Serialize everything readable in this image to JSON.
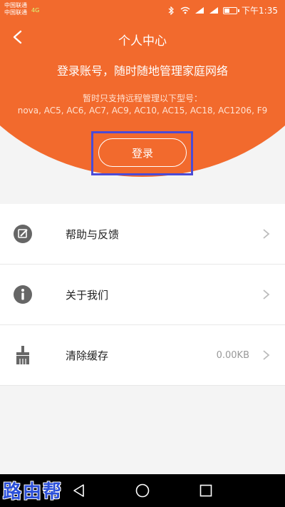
{
  "status_bar": {
    "carrier_1": "中国联通",
    "carrier_2": "中国联通",
    "net_badge": "4G",
    "time": "下午1:35",
    "icons": [
      "bluetooth-icon",
      "wifi-icon",
      "signal-icon",
      "battery-icon"
    ]
  },
  "header": {
    "title": "个人中心",
    "tagline": "登录账号，随时随地管理家庭网络",
    "support_note": "暂时只支持远程管理以下型号：",
    "models": "nova, AC5, AC6, AC7, AC9, AC10, AC15, AC18, AC1206, F9",
    "login_label": "登录",
    "accent_color": "#f26a2d",
    "highlight_color": "#4b4bd6"
  },
  "menu": {
    "items": [
      {
        "label": "帮助与反馈",
        "icon": "feedback-edit-icon",
        "value": ""
      },
      {
        "label": "关于我们",
        "icon": "info-icon",
        "value": ""
      },
      {
        "label": "清除缓存",
        "icon": "broom-icon",
        "value": "0.00KB"
      }
    ]
  },
  "watermark": {
    "text": [
      "路",
      "由",
      "帮"
    ]
  }
}
